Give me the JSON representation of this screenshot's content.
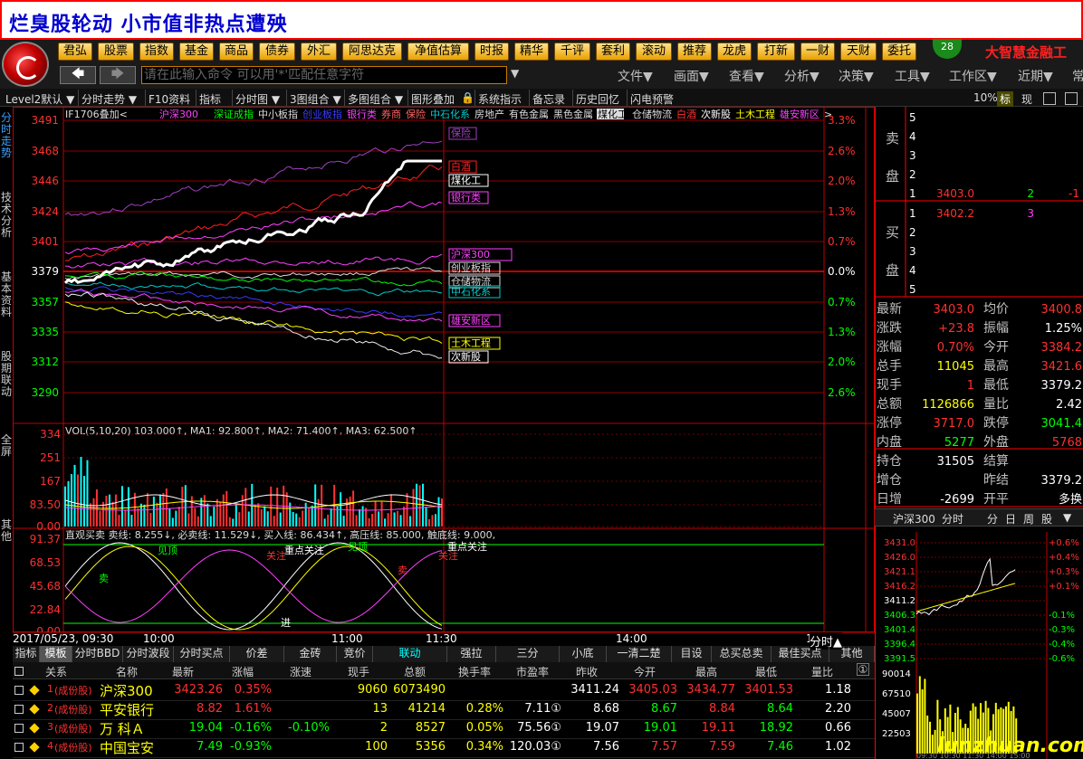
{
  "banner": {
    "title": "烂臭股轮动 小市值非热点遭殃"
  },
  "toolbar1": {
    "buttons": [
      "君弘",
      "股票",
      "指数",
      "基金",
      "商品",
      "债券",
      "外汇",
      "阿思达克",
      "净值估算",
      "时报",
      "精华",
      "千评",
      "套利",
      "滚动",
      "推荐",
      "龙虎",
      "打新",
      "一财",
      "天财",
      "委托"
    ],
    "badge": "28",
    "brand": "大智慧金融工"
  },
  "toolbar2": {
    "back": "🡄",
    "forward": "🡆",
    "command_placeholder": "请在此输入命令  可以用'*'匹配任意字符",
    "menus": [
      "文件▼",
      "画面▼",
      "查看▼",
      "分析▼",
      "决策▼",
      "工具▼",
      "工作区▼",
      "近期▼",
      "常"
    ]
  },
  "toolbar3": {
    "items": [
      "Level2默认 ▼",
      "分时走势 ▼",
      "F10资料",
      "指标",
      "分时图 ▼",
      "3图组合 ▼",
      "多图组合 ▼",
      "图形叠加",
      "系统指示",
      "备忘录",
      "历史回忆",
      "闪电预警"
    ],
    "zoom": "10%",
    "tab_biao": "标",
    "tab_xian": "现"
  },
  "left_tabs": [
    "分时走势",
    "技术分析",
    "基本资料",
    "股期联动",
    "全屏",
    "其他"
  ],
  "chart": {
    "overlay_header": [
      "IF1706叠加<",
      "沪深300",
      "深证成指",
      "中小板指",
      "创业板指",
      "银行类",
      "券商",
      "保险",
      "中石化系",
      "房地产",
      "有色金属",
      "黑色金属",
      "煤化工",
      "仓储物流",
      "白酒",
      "次新股",
      "土木工程",
      "雄安新区",
      ">"
    ],
    "price_ticks": [
      "3491",
      "3468",
      "3446",
      "3424",
      "3401",
      "3379",
      "3357",
      "3335",
      "3312",
      "3290"
    ],
    "pct_ticks": [
      "3.3%",
      "2.6%",
      "2.0%",
      "1.3%",
      "0.7%",
      "0.0%",
      "0.7%",
      "1.3%",
      "2.0%",
      "2.6%"
    ],
    "series_labels": [
      "保险",
      "白酒",
      "煤化工",
      "银行类",
      "沪深300",
      "创业板指",
      "仓储物流",
      "中石化系",
      "雄安新区",
      "土木工程",
      "次新股"
    ],
    "vol_header": "VOL(5,10,20) 103.000↑, MA1: 92.800↑, MA2: 71.400↑, MA3: 62.500↑",
    "vol_ticks": [
      "334",
      "251",
      "167",
      "83.50",
      "0.00"
    ],
    "ind_header": "直观买卖  卖线: 8.255↓, 必卖线: 11.529↓, 买入线: 86.434↑, 高压线: 85.000, 触底线: 9.000,",
    "ind_ticks": [
      "91.37",
      "68.53",
      "45.68",
      "22.84",
      "0.00"
    ],
    "ind_labels": [
      "关注",
      "重点关注",
      "卖",
      "见顶",
      "见顶",
      "关注",
      "重点关注",
      "进",
      "卖"
    ],
    "time_labels": [
      "2017/05/23, 09:30",
      "10:00",
      "11:00",
      "11:30",
      "14:00",
      "15:00"
    ],
    "fenshi": "分时▲"
  },
  "quote": {
    "sell": [
      {
        "n": "5",
        "p": "",
        "v": ""
      },
      {
        "n": "4",
        "p": "",
        "v": ""
      },
      {
        "n": "3",
        "p": "",
        "v": ""
      },
      {
        "n": "2",
        "p": "",
        "v": ""
      },
      {
        "n": "1",
        "p": "3403.0",
        "v": "2"
      }
    ],
    "sell_delta": "-1",
    "buy": [
      {
        "n": "1",
        "p": "3402.2",
        "v": "3"
      },
      {
        "n": "2",
        "p": "",
        "v": ""
      },
      {
        "n": "3",
        "p": "",
        "v": ""
      },
      {
        "n": "4",
        "p": "",
        "v": ""
      },
      {
        "n": "5",
        "p": "",
        "v": ""
      }
    ],
    "sell_label": [
      "卖",
      "盘"
    ],
    "buy_label": [
      "买",
      "盘"
    ],
    "stats": [
      {
        "l": "最新",
        "v": "3403.0",
        "c": "red",
        "l2": "均价",
        "v2": "3400.8",
        "c2": "red"
      },
      {
        "l": "涨跌",
        "v": "+23.8",
        "c": "red",
        "l2": "振幅",
        "v2": "1.25%",
        "c2": "white"
      },
      {
        "l": "涨幅",
        "v": "0.70%",
        "c": "red",
        "l2": "今开",
        "v2": "3384.2",
        "c2": "red"
      },
      {
        "l": "总手",
        "v": "11045",
        "c": "yellow",
        "l2": "最高",
        "v2": "3421.6",
        "c2": "red"
      },
      {
        "l": "现手",
        "v": "1",
        "c": "red",
        "l2": "最低",
        "v2": "3379.2",
        "c2": "white"
      },
      {
        "l": "总额",
        "v": "1126866",
        "c": "yellow",
        "l2": "量比",
        "v2": "2.42",
        "c2": "white"
      },
      {
        "l": "涨停",
        "v": "3717.0",
        "c": "red",
        "l2": "跌停",
        "v2": "3041.4",
        "c2": "green"
      },
      {
        "l": "内盘",
        "v": "5277",
        "c": "green",
        "l2": "外盘",
        "v2": "5768",
        "c2": "red"
      },
      {
        "l": "持仓",
        "v": "31505",
        "c": "white",
        "l2": "结算",
        "v2": "",
        "c2": "white"
      },
      {
        "l": "增仓",
        "v": "",
        "c": "white",
        "l2": "昨结",
        "v2": "3379.2",
        "c2": "white"
      },
      {
        "l": "日增",
        "v": "-2699",
        "c": "white",
        "l2": "开平",
        "v2": "多换",
        "c2": "white"
      }
    ]
  },
  "mini": {
    "tabs": [
      "沪深300",
      "分时",
      "分",
      "日",
      "周",
      "股",
      "▼"
    ],
    "price_ticks": [
      "3431.0",
      "3426.0",
      "3421.1",
      "3416.2",
      "3411.2",
      "3406.3",
      "3401.4",
      "3396.4",
      "3391.5"
    ],
    "pct_ticks": [
      "+0.6%",
      "+0.4%",
      "+0.3%",
      "+0.1%",
      "",
      "-0.1%",
      "-0.3%",
      "-0.4%",
      "-0.6%"
    ],
    "vol_ticks": [
      "90014",
      "67510",
      "45007",
      "22503"
    ],
    "times": "09:30 10:30 11:30 14:00 15:00",
    "watermark": "lunzhuan.com"
  },
  "bottom_tabs": [
    "指标",
    "模板",
    "分时BBD",
    "分时波段",
    "分时买点",
    "价差",
    "金砖",
    "竞价",
    "联动",
    "强拉",
    "三分",
    "小底",
    "一清二楚",
    "目设",
    "总买总卖",
    "最佳买点",
    "其他"
  ],
  "table": {
    "headers": [
      "关系",
      "名称",
      "最新",
      "涨幅",
      "涨速",
      "现手",
      "总额",
      "换手率",
      "市盈率",
      "昨收",
      "今开",
      "最高",
      "最低",
      "量比"
    ],
    "rows": [
      {
        "idx": "1",
        "tag": "(成份股)",
        "name": "沪深300",
        "last": "3423.26",
        "chg": "0.35%",
        "speed": "",
        "vol": "9060",
        "amt": "6073490",
        "turn": "",
        "pe": "",
        "prev": "3411.24",
        "open": "3405.03",
        "high": "3434.77",
        "low": "3401.53",
        "vr": "1.18",
        "lastc": "red",
        "chgc": "red",
        "openc": "red",
        "highc": "red",
        "lowc": "red"
      },
      {
        "idx": "2",
        "tag": "(成份股)",
        "name": "平安银行",
        "last": "8.82",
        "chg": "1.61%",
        "speed": "",
        "vol": "13",
        "amt": "41214",
        "turn": "0.28%",
        "pe": "7.11①",
        "prev": "8.68",
        "open": "8.67",
        "high": "8.84",
        "low": "8.64",
        "vr": "2.20",
        "lastc": "red",
        "chgc": "red",
        "openc": "green",
        "highc": "red",
        "lowc": "green"
      },
      {
        "idx": "3",
        "tag": "(成份股)",
        "name": "万 科Ａ",
        "last": "19.04",
        "chg": "-0.16%",
        "speed": "-0.10%",
        "vol": "2",
        "amt": "8527",
        "turn": "0.05%",
        "pe": "75.56①",
        "prev": "19.07",
        "open": "19.01",
        "high": "19.11",
        "low": "18.92",
        "vr": "0.66",
        "lastc": "green",
        "chgc": "green",
        "openc": "green",
        "highc": "red",
        "lowc": "green"
      },
      {
        "idx": "4",
        "tag": "(成份股)",
        "name": "中国宝安",
        "last": "7.49",
        "chg": "-0.93%",
        "speed": "",
        "vol": "100",
        "amt": "5356",
        "turn": "0.34%",
        "pe": "120.03①",
        "prev": "7.56",
        "open": "7.57",
        "high": "7.59",
        "low": "7.46",
        "vr": "1.02",
        "lastc": "green",
        "chgc": "green",
        "openc": "red",
        "highc": "red",
        "lowc": "green"
      }
    ]
  },
  "colors": {
    "up": "#ff3030",
    "down": "#00ff00",
    "grid": "#c00000",
    "accent": "#ffe28a",
    "brand": "#ff2020"
  }
}
